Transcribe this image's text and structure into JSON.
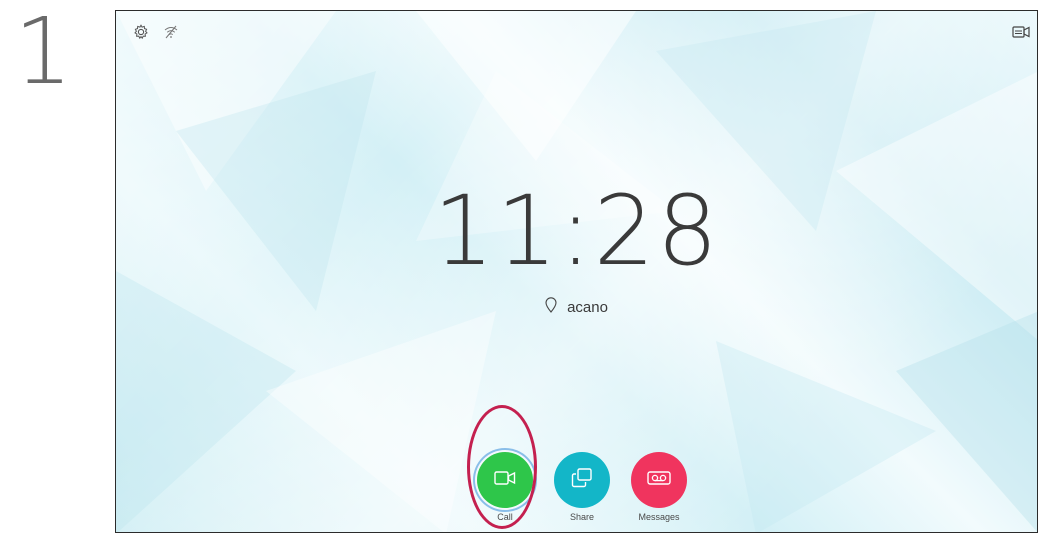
{
  "step": {
    "number": "1"
  },
  "status_bar": {
    "settings_icon": "gear-icon",
    "wifi_icon": "wifi-off-icon",
    "selfview_icon": "video-selfview-icon"
  },
  "clock": {
    "time": "11:28"
  },
  "location": {
    "icon": "location-pin-icon",
    "name": "acano"
  },
  "actions": {
    "call": {
      "label": "Call",
      "color": "#2ec64a",
      "icon": "video-camera-icon"
    },
    "share": {
      "label": "Share",
      "color": "#13b6c8",
      "icon": "share-screens-icon"
    },
    "messages": {
      "label": "Messages",
      "color": "#f0345e",
      "icon": "voicemail-icon"
    }
  },
  "annotation": {
    "highlight_color": "#c4204f"
  }
}
